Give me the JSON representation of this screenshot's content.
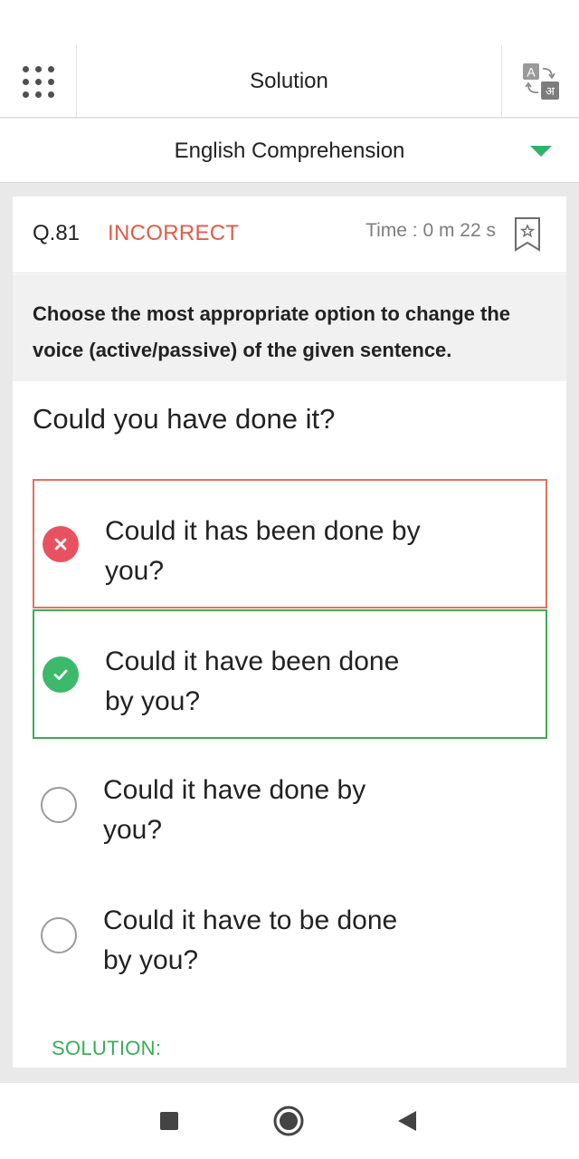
{
  "app_bar": {
    "title": "Solution",
    "menu_icon": "grid-menu-icon",
    "translate_icon": "translate-icon",
    "translate_glyph_latin": "A",
    "translate_glyph_hindi": "अ"
  },
  "section": {
    "name": "English Comprehension",
    "caret_icon": "caret-down-icon",
    "accent_color": "#2fb36b"
  },
  "question": {
    "number": "Q.81",
    "status": "INCORRECT",
    "status_color": "#e25c46",
    "time": "Time : 0 m 22 s",
    "bookmark_icon": "bookmark-star-icon",
    "instruction": "Choose the most appropriate option to change the voice (active/passive) of the given sentence.",
    "text": "Could you have done it?",
    "options": [
      {
        "text": "Could it has been done by you?",
        "state": "wrong",
        "icon": "cross-icon"
      },
      {
        "text": "Could it have been done by you?",
        "state": "correct",
        "icon": "check-icon"
      },
      {
        "text": "Could it have done by you?",
        "state": "unselected",
        "icon": "radio-icon"
      },
      {
        "text": "Could it have to be done by you?",
        "state": "unselected",
        "icon": "radio-icon"
      }
    ],
    "solution_label": "SOLUTION:",
    "solution_color": "#3cab5a"
  },
  "nav": {
    "recents_icon": "square-recents-icon",
    "home_icon": "circle-home-icon",
    "back_icon": "triangle-back-icon"
  }
}
